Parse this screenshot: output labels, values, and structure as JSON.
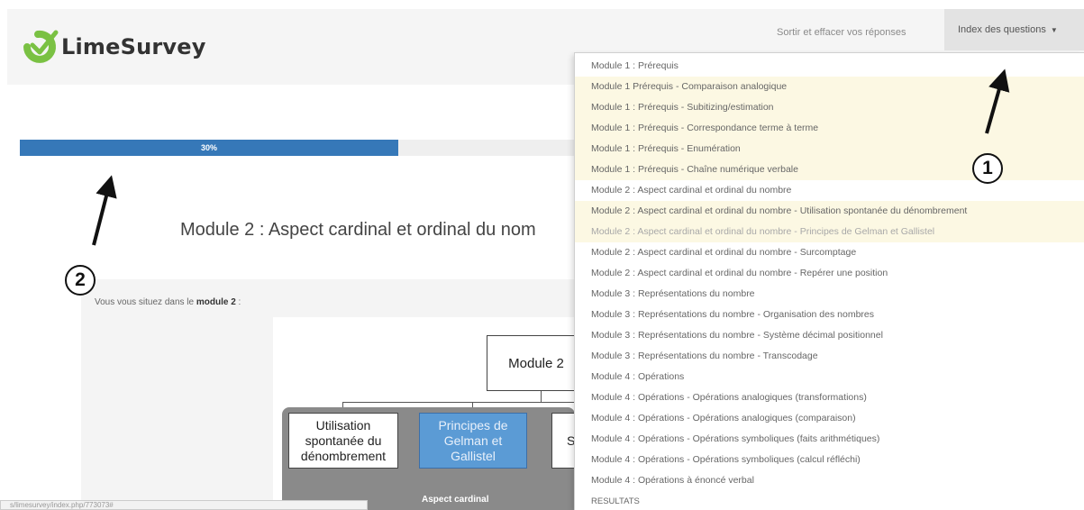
{
  "header": {
    "logo_text": "LimeSurvey",
    "exit_link": "Sortir et effacer vos réponses",
    "index_button": "Index des questions",
    "index_caret": "▼"
  },
  "progress": {
    "label": "30%",
    "value": 0.3
  },
  "module_heading": "Module 2 : Aspect cardinal et ordinal du nom",
  "intro": {
    "prefix": "Vous vous situez dans le ",
    "bold": "module 2",
    "suffix": " :"
  },
  "diagram": {
    "root": "Module 2",
    "child1": "Utilisation spontanée du dénombrement",
    "child2": "Principes de Gelman et Gallistel",
    "child3": "Su",
    "group_label": "Aspect cardinal"
  },
  "status_bar": "s/limesurvey/index.php/773073#",
  "dropdown_items": [
    {
      "label": "Module 1 : Prérequis",
      "state": "normal"
    },
    {
      "label": "Module 1 Prérequis - Comparaison analogique",
      "state": "hl"
    },
    {
      "label": "Module 1 : Prérequis - Subitizing/estimation",
      "state": "hl"
    },
    {
      "label": "Module 1 : Prérequis - Correspondance terme à terme",
      "state": "hl"
    },
    {
      "label": "Module 1 : Prérequis - Enumération",
      "state": "hl"
    },
    {
      "label": "Module 1 : Prérequis - Chaîne numérique verbale",
      "state": "hl"
    },
    {
      "label": "Module 2 : Aspect cardinal et ordinal du nombre",
      "state": "normal"
    },
    {
      "label": "Module 2 : Aspect cardinal et ordinal du nombre - Utilisation spontanée du dénombrement",
      "state": "hl"
    },
    {
      "label": "Module 2 : Aspect cardinal et ordinal du nombre - Principes de Gelman et Gallistel",
      "state": "hl-dim"
    },
    {
      "label": "Module 2 : Aspect cardinal et ordinal du nombre - Surcomptage",
      "state": "normal"
    },
    {
      "label": "Module 2 : Aspect cardinal et ordinal du nombre - Repérer une position",
      "state": "normal"
    },
    {
      "label": "Module 3 : Représentations du nombre",
      "state": "normal"
    },
    {
      "label": "Module 3 : Représentations du nombre - Organisation des nombres",
      "state": "normal"
    },
    {
      "label": "Module 3 : Représentations du nombre - Système décimal positionnel",
      "state": "normal"
    },
    {
      "label": "Module 3 : Représentations du nombre - Transcodage",
      "state": "normal"
    },
    {
      "label": "Module 4 : Opérations",
      "state": "normal"
    },
    {
      "label": "Module 4 : Opérations - Opérations analogiques (transformations)",
      "state": "normal"
    },
    {
      "label": "Module 4 : Opérations - Opérations analogiques (comparaison)",
      "state": "normal"
    },
    {
      "label": "Module 4 : Opérations - Opérations symboliques (faits arithmétiques)",
      "state": "normal"
    },
    {
      "label": "Module 4 : Opérations - Opérations symboliques (calcul réfléchi)",
      "state": "normal"
    },
    {
      "label": "Module 4 : Opérations à énoncé verbal",
      "state": "normal"
    },
    {
      "label": "RESULTATS",
      "state": "upper"
    }
  ],
  "annotations": {
    "one": "1",
    "two": "2"
  },
  "colors": {
    "progress": "#3678b8",
    "highlight_row": "#fcf8e3",
    "selected_box": "#5b9bd5",
    "logo_green": "#7ac143"
  }
}
